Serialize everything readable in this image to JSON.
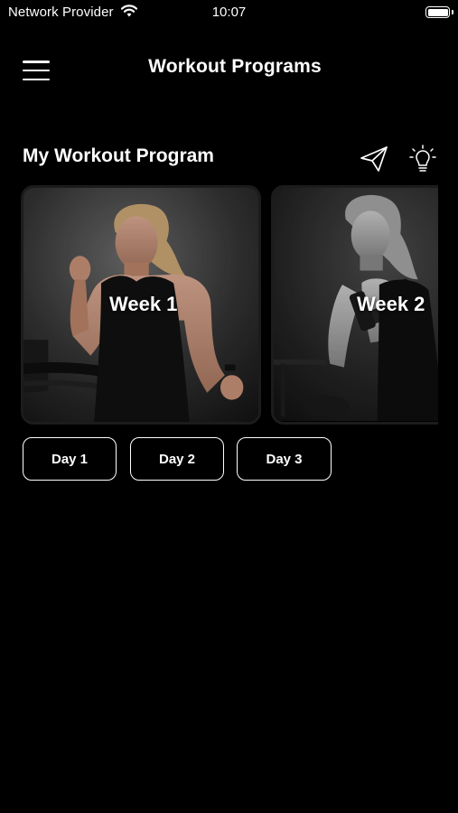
{
  "status_bar": {
    "carrier": "Network Provider",
    "time": "10:07"
  },
  "header": {
    "title": "Workout Programs",
    "menu_icon": "hamburger-menu-icon"
  },
  "section": {
    "title": "My Workout Program",
    "share_icon": "paper-plane-icon",
    "tips_icon": "lightbulb-icon"
  },
  "weeks": [
    {
      "label": "Week 1"
    },
    {
      "label": "Week 2"
    }
  ],
  "days": [
    {
      "label": "Day 1"
    },
    {
      "label": "Day 2"
    },
    {
      "label": "Day 3"
    }
  ],
  "colors": {
    "background": "#000000",
    "text": "#ffffff",
    "card_border": "#1c1c1c"
  }
}
